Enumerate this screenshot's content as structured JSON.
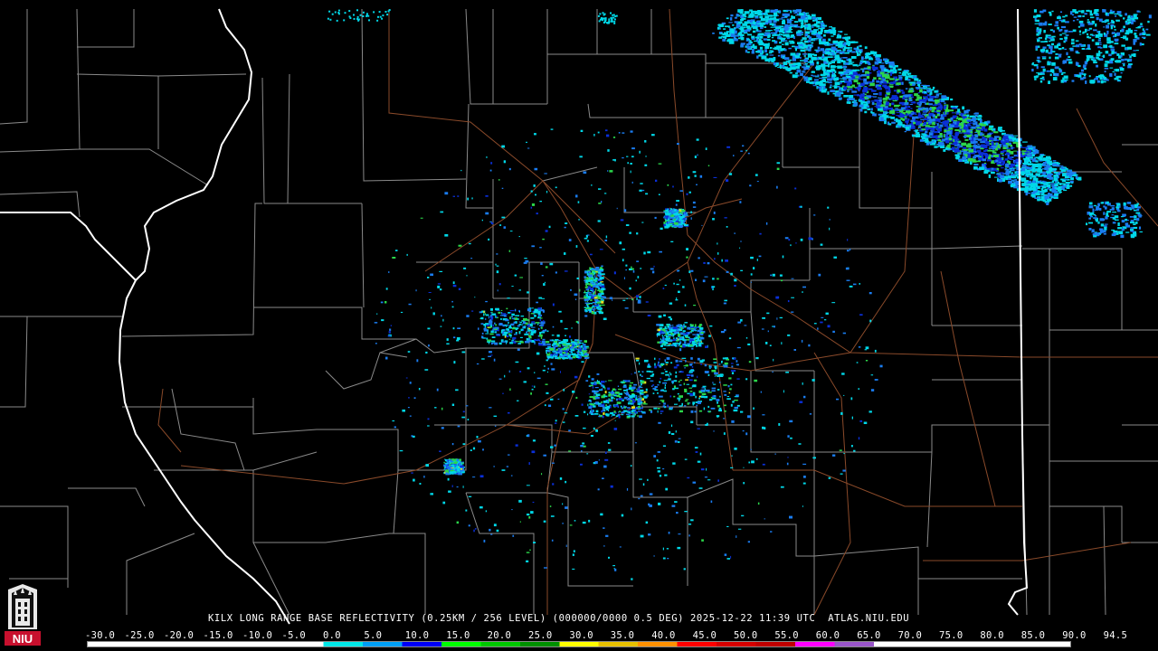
{
  "product": {
    "station": "KILX",
    "caption": "KILX LONG RANGE BASE REFLECTIVITY (0.25KM / 256 LEVEL) (000000/0000 0.5 DEG) 2025-12-22 11:39 UTC  ATLAS.NIU.EDU"
  },
  "logo": {
    "text": "NIU",
    "icon": "niu-tower-logo-icon"
  },
  "scale": {
    "ticks": [
      "-30.0",
      "-25.0",
      "-20.0",
      "-15.0",
      "-10.0",
      "-5.0",
      "0.0",
      "5.0",
      "10.0",
      "15.0",
      "20.0",
      "25.0",
      "30.0",
      "35.0",
      "40.0",
      "45.0",
      "50.0",
      "55.0",
      "60.0",
      "65.0",
      "70.0",
      "75.0",
      "80.0",
      "85.0",
      "90.0",
      "94.5"
    ],
    "colors": [
      "#ffffff",
      "#ffffff",
      "#ffffff",
      "#ffffff",
      "#ffffff",
      "#ffffff",
      "#00e8e8",
      "#00a0f6",
      "#0000f6",
      "#00ff00",
      "#00c800",
      "#009000",
      "#ffff00",
      "#e7c000",
      "#ff9000",
      "#ff0000",
      "#d60000",
      "#c00000",
      "#ff00ff",
      "#9955c9",
      "#ffffff",
      "#ffffff",
      "#ffffff",
      "#ffffff",
      "#ffffff"
    ]
  },
  "colors": {
    "background": "#000000",
    "county_lines": "#8a8a8a",
    "state_lines": "#ffffff",
    "roads": "#8a4a2a",
    "echo_light": "#00d8e8",
    "echo_mid": "#1a7cf0",
    "echo_blue": "#0a2fd8",
    "echo_green": "#2bd64a",
    "echo_yellow": "#e8e020"
  }
}
